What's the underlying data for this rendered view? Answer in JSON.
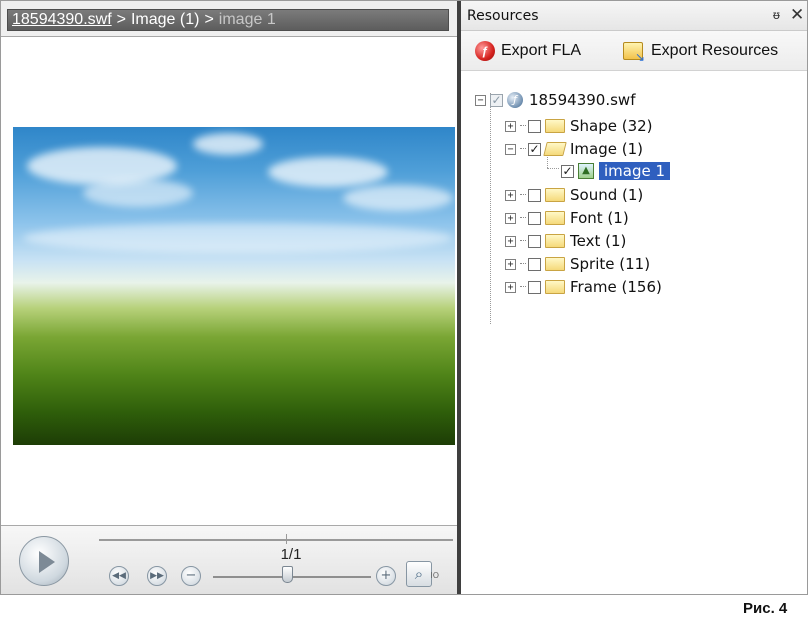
{
  "breadcrumb": {
    "items": [
      "18594390.swf",
      "Image (1)",
      "image 1"
    ],
    "separator": ">"
  },
  "preview": {
    "frame_counter": "1/1",
    "zoom_level_fraction": 0.41
  },
  "resources_panel": {
    "title": "Resources",
    "pin_icon": "pin-icon",
    "close_icon": "close-icon",
    "toolbar": {
      "export_fla_label": "Export FLA",
      "export_resources_label": "Export Resources"
    },
    "tree": {
      "root_label": "18594390.swf",
      "items": [
        {
          "label": "Shape (32)",
          "checked": false
        },
        {
          "label": "Image (1)",
          "checked": true,
          "expanded": true
        },
        {
          "label": "image 1",
          "checked": true,
          "selected": true
        },
        {
          "label": "Sound (1)",
          "checked": false
        },
        {
          "label": "Font (1)",
          "checked": false
        },
        {
          "label": "Text (1)",
          "checked": false
        },
        {
          "label": "Sprite (11)",
          "checked": false
        },
        {
          "label": "Frame (156)",
          "checked": false
        }
      ]
    }
  },
  "colors": {
    "selection": "#2f5fbf",
    "splitter": "#3f3f3f",
    "breadcrumb_bg": "#666666"
  },
  "caption": "Рис. 4"
}
